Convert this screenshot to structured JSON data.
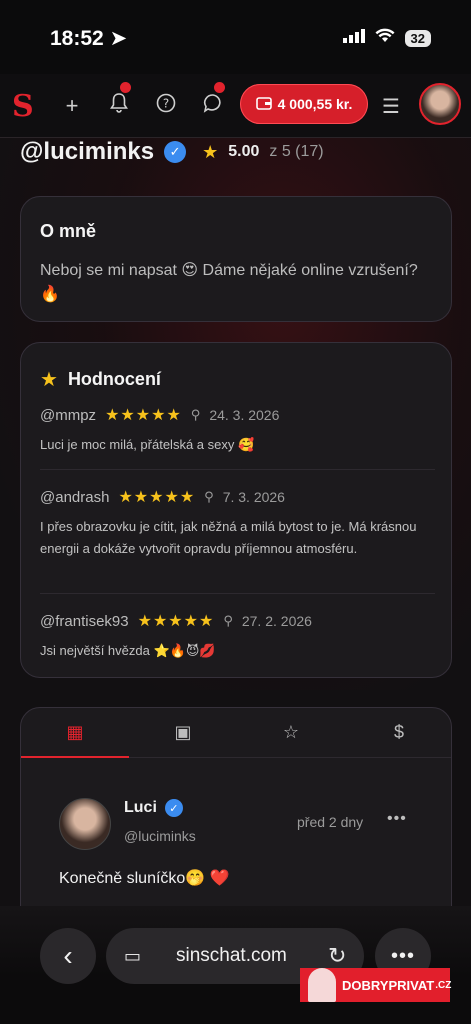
{
  "status": {
    "time": "18:52",
    "battery": "32"
  },
  "header": {
    "logo": "S",
    "wallet_balance": "4 000,55 kr.",
    "colors": {
      "accent": "#e2232d"
    }
  },
  "profile": {
    "username": "@luciminks",
    "rating": "5.00",
    "rating_rest": "z 5 (17)"
  },
  "about": {
    "title": "O mně",
    "text": "Neboj se mi napsat 😍 Dáme nějaké online vzrušení? 🔥"
  },
  "reviews": {
    "title": "Hodnocení",
    "items": [
      {
        "author": "@mmpz",
        "stars": "★★★★★",
        "date": "24. 3. 2026",
        "text": "Luci je moc milá, přátelská a sexy 🥰"
      },
      {
        "author": "@andrash",
        "stars": "★★★★★",
        "date": "7. 3. 2026",
        "text": "I přes obrazovku je cítit, jak něžná a milá bytost to je. Má krásnou energii a dokáže vytvořit opravdu příjemnou atmosféru."
      },
      {
        "author": "@frantisek93",
        "stars": "★★★★★",
        "date": "27. 2. 2026",
        "text": "Jsi největší hvězda ⭐🔥😈💋"
      }
    ]
  },
  "feed": {
    "tabs": [
      {
        "icon": "grid-icon",
        "glyph": "▦",
        "active": true
      },
      {
        "icon": "image-icon",
        "glyph": "▣",
        "active": false
      },
      {
        "icon": "star-icon",
        "glyph": "☆",
        "active": false
      },
      {
        "icon": "dollar-icon",
        "glyph": "$",
        "active": false
      }
    ],
    "post": {
      "name": "Luci",
      "handle": "@luciminks",
      "time": "před 2 dny",
      "text": "Konečně sluníčko🤭 ❤️"
    }
  },
  "browser": {
    "url": "sinschat.com"
  },
  "watermark": {
    "text": "DOBRYPRIVAT",
    "suffix": ".CZ"
  }
}
